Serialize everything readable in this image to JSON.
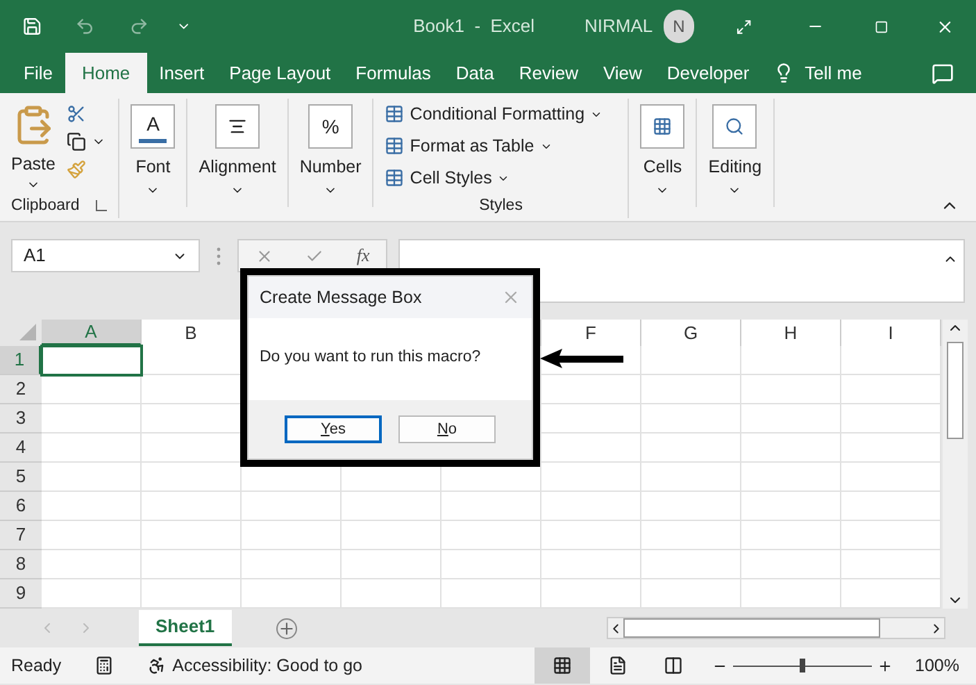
{
  "window": {
    "title": "Book1  -  Excel",
    "user": "NIRMAL",
    "avatar": "N"
  },
  "ribbon_tabs": [
    {
      "label": "File",
      "selected": false
    },
    {
      "label": "Home",
      "selected": true
    },
    {
      "label": "Insert",
      "selected": false
    },
    {
      "label": "Page Layout",
      "selected": false
    },
    {
      "label": "Formulas",
      "selected": false
    },
    {
      "label": "Data",
      "selected": false
    },
    {
      "label": "Review",
      "selected": false
    },
    {
      "label": "View",
      "selected": false
    },
    {
      "label": "Developer",
      "selected": false
    }
  ],
  "tell_me": "Tell me",
  "ribbon": {
    "paste": "Paste",
    "clipboard": "Clipboard",
    "font": "Font",
    "font_icon": "A",
    "alignment": "Alignment",
    "number": "Number",
    "number_icon": "%",
    "styles": [
      "Conditional Formatting",
      "Format as Table",
      "Cell Styles"
    ],
    "styles_label": "Styles",
    "cells": "Cells",
    "editing": "Editing"
  },
  "formula_bar": {
    "name_box": "A1",
    "function_label": "fx"
  },
  "columns": [
    {
      "label": "A",
      "selected": true
    },
    {
      "label": "B",
      "selected": false
    },
    {},
    {},
    {},
    {
      "label": "F",
      "selected": false
    },
    {
      "label": "G",
      "selected": false
    },
    {
      "label": "H",
      "selected": false
    },
    {
      "label": "I",
      "selected": false
    }
  ],
  "rows": [
    {
      "label": "1",
      "selected": true
    },
    {
      "label": "2",
      "selected": false
    },
    {
      "label": "3",
      "selected": false
    },
    {
      "label": "4",
      "selected": false
    },
    {
      "label": "5",
      "selected": false
    },
    {
      "label": "6",
      "selected": false
    },
    {
      "label": "7",
      "selected": false
    },
    {
      "label": "8",
      "selected": false
    },
    {
      "label": "9",
      "selected": false
    }
  ],
  "dialog": {
    "title": "Create Message Box",
    "message": "Do you want to run this macro?",
    "buttons": [
      {
        "label": "Yes",
        "default": true
      },
      {
        "label": "No",
        "default": false
      }
    ]
  },
  "sheet_tabs": [
    {
      "label": "Sheet1",
      "selected": true
    }
  ],
  "status_bar": {
    "ready": "Ready",
    "accessibility": "Accessibility: Good to go",
    "views": [
      {
        "kind": "normal",
        "selected": true
      },
      {
        "kind": "page_layout",
        "selected": false
      },
      {
        "kind": "page_break",
        "selected": false
      }
    ],
    "zoom": {
      "text": "100%",
      "level": 0.5
    }
  }
}
